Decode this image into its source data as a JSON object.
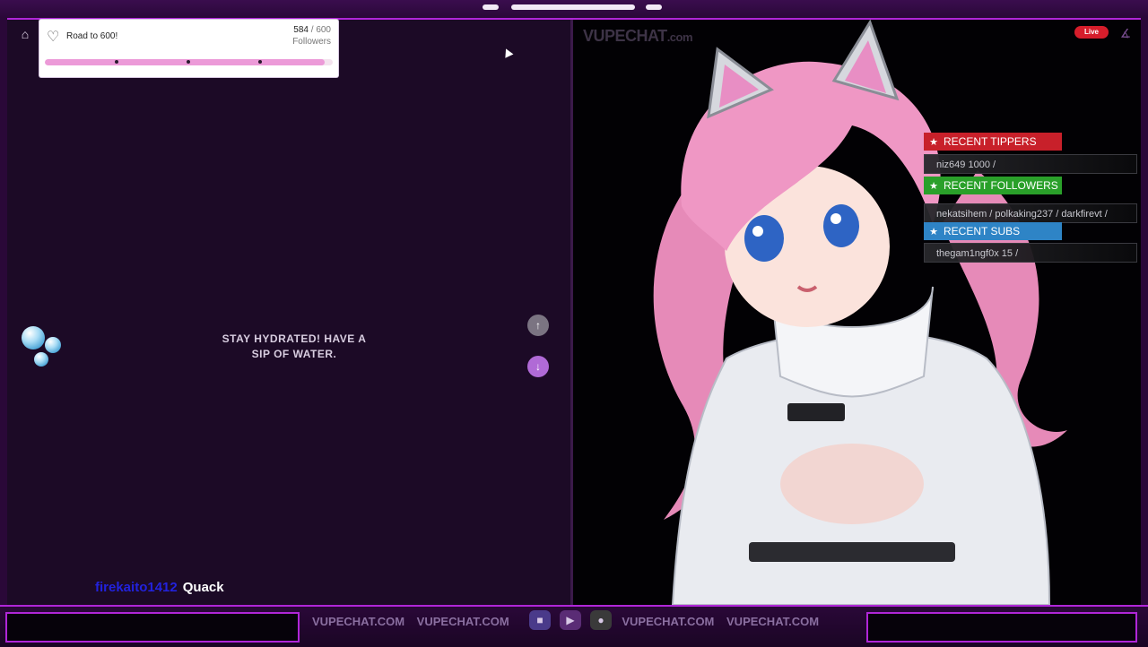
{
  "top_frame": {
    "pills": [
      "",
      "",
      ""
    ]
  },
  "goal": {
    "title": "Road to 600!",
    "current": "584",
    "separator": " / ",
    "target": "600",
    "unit": "Followers",
    "progress_fraction": 0.973
  },
  "left_panel": {
    "hydration_line1": "STAY HYDRATED! HAVE A",
    "hydration_line2": "SIP OF WATER."
  },
  "chat": {
    "username": "firekaito1412",
    "message": "Quack"
  },
  "ticker": {
    "items": [
      "VUPECHAT.COM",
      "VUPECHAT.COM",
      "VUPECHAT.COM",
      "VUPECHAT.COM",
      "VUPECHAT.COM"
    ]
  },
  "brand": {
    "name": "VUPECHAT",
    "suffix": ".com"
  },
  "live_badge": "Live",
  "events": {
    "tippers_title": "RECENT TIPPERS",
    "tippers_value": "niz649  1000 /",
    "followers_title": "RECENT FOLLOWERS",
    "followers_value": "nekatsihem / polkaking237 / darkfirevt /",
    "subs_title": "RECENT SUBS",
    "subs_value": "thegam1ngf0x  15 /"
  },
  "colors": {
    "frame_accent": "#b026d8",
    "tippers": "#c8202a",
    "followers": "#2aa02a",
    "subs": "#2e84c6",
    "goal_fill": "#ec9ad8"
  },
  "icons": [
    "home-icon",
    "heart-cloud-icon",
    "up-arrow-icon",
    "down-arrow-icon",
    "star-icon",
    "game-controller-icon"
  ]
}
